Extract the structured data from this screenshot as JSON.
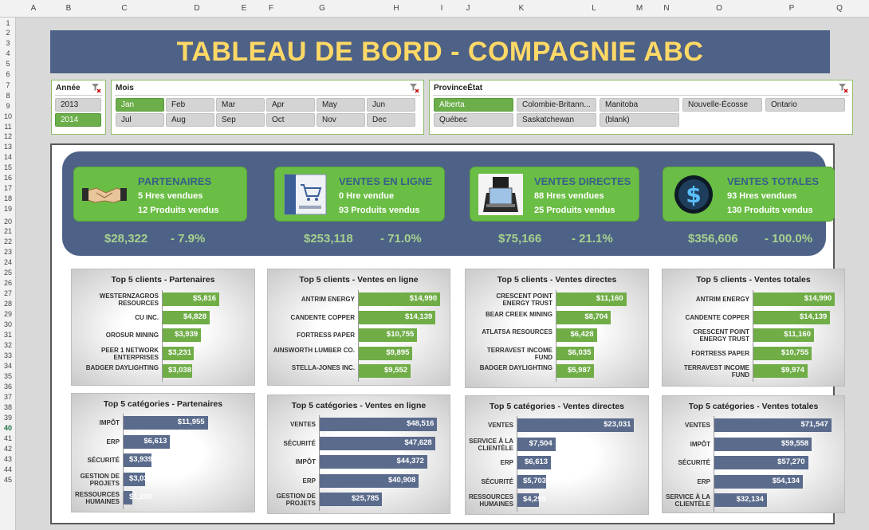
{
  "sheet": {
    "columns": [
      "A",
      "B",
      "C",
      "D",
      "E",
      "F",
      "G",
      "H",
      "I",
      "J",
      "K",
      "L",
      "M",
      "N",
      "O",
      "P",
      "Q"
    ],
    "rows": [
      "1",
      "2",
      "3",
      "4",
      "5",
      "6",
      "7",
      "8",
      "9",
      "10",
      "11",
      "12",
      "13",
      "14",
      "15",
      "16",
      "17",
      "18",
      "19",
      "20",
      "21",
      "22",
      "23",
      "24",
      "25",
      "26",
      "27",
      "28",
      "29",
      "30",
      "31",
      "32",
      "33",
      "34",
      "35",
      "36",
      "37",
      "38",
      "39",
      "40",
      "41",
      "42",
      "43",
      "44",
      "45"
    ],
    "selected_row": "40"
  },
  "title": "TABLEAU DE BORD - COMPAGNIE ABC",
  "slicers": {
    "annee": {
      "header": "Année",
      "items": [
        {
          "label": "2013",
          "on": false
        },
        {
          "label": "2014",
          "on": true
        }
      ]
    },
    "mois": {
      "header": "Mois",
      "items": [
        {
          "label": "Jan",
          "on": true
        },
        {
          "label": "Feb",
          "on": false
        },
        {
          "label": "Mar",
          "on": false
        },
        {
          "label": "Apr",
          "on": false
        },
        {
          "label": "May",
          "on": false
        },
        {
          "label": "Jun",
          "on": false
        },
        {
          "label": "Jul",
          "on": false
        },
        {
          "label": "Aug",
          "on": false
        },
        {
          "label": "Sep",
          "on": false
        },
        {
          "label": "Oct",
          "on": false
        },
        {
          "label": "Nov",
          "on": false
        },
        {
          "label": "Dec",
          "on": false
        }
      ]
    },
    "province": {
      "header": "ProvinceÉtat",
      "items": [
        {
          "label": "Alberta",
          "on": true
        },
        {
          "label": "Colombie-Britann...",
          "on": false
        },
        {
          "label": "Manitoba",
          "on": false
        },
        {
          "label": "Nouvelle-Écosse",
          "on": false
        },
        {
          "label": "Ontario",
          "on": false
        },
        {
          "label": "Québec",
          "on": false
        },
        {
          "label": "Saskatchewan",
          "on": false
        },
        {
          "label": "(blank)",
          "on": false
        }
      ]
    }
  },
  "kpis": [
    {
      "name": "PARTENAIRES",
      "line1": "5 Hres vendues",
      "line2": "12 Produits vendus",
      "amount": "$28,322",
      "pct": "- 7.9%",
      "icon": "handshake-icon"
    },
    {
      "name": "VENTES EN LIGNE",
      "line1": "0 Hre vendue",
      "line2": "93 Produits vendus",
      "amount": "$253,118",
      "pct": "- 71.0%",
      "icon": "online-cart-icon"
    },
    {
      "name": "VENTES DIRECTES",
      "line1": "88 Hres vendues",
      "line2": "25 Produits vendus",
      "amount": "$75,166",
      "pct": "- 21.1%",
      "icon": "salesperson-laptop-icon"
    },
    {
      "name": "VENTES TOTALES",
      "line1": "93 Hres vendues",
      "line2": "130 Produits vendus",
      "amount": "$356,606",
      "pct": "- 100.0%",
      "icon": "dollar-coin-icon"
    }
  ],
  "colors": {
    "kpi_green": "#6bbe45",
    "band_navy": "#4e6287",
    "title_gold": "#ffd966",
    "bar_green": "#70ad47",
    "bar_slate": "#5a6b8c"
  },
  "chart_data": [
    {
      "type": "bar",
      "title": "Top 5 clients - Partenaires",
      "categories": [
        "WESTERNZAGROS RESOURCES",
        "CU INC.",
        "OROSUR MINING",
        "PEER 1 NETWORK ENTERPRISES",
        "BADGER DAYLIGHTING"
      ],
      "values": [
        5816,
        4828,
        3939,
        3231,
        3038
      ],
      "value_labels": [
        "$5,816",
        "$4,828",
        "$3,939",
        "$3,231",
        "$3,038"
      ],
      "xlim": [
        0,
        9000
      ]
    },
    {
      "type": "bar",
      "title": "Top 5 clients - Ventes en ligne",
      "categories": [
        "ANTRIM ENERGY",
        "CANDENTE COPPER",
        "FORTRESS PAPER",
        "AINSWORTH LUMBER CO.",
        "STELLA-JONES INC."
      ],
      "values": [
        14990,
        14139,
        10755,
        9895,
        9552
      ],
      "value_labels": [
        "$14,990",
        "$14,139",
        "$10,755",
        "$9,895",
        "$9,552"
      ],
      "xlim": [
        0,
        16000
      ]
    },
    {
      "type": "bar",
      "title": "Top 5 clients - Ventes directes",
      "categories": [
        "CRESCENT POINT ENERGY TRUST",
        "BEAR CREEK MINING",
        "ATLATSA RESOURCES",
        "TERRAVEST INCOME FUND",
        "BADGER DAYLIGHTING"
      ],
      "values": [
        11160,
        8704,
        6428,
        6035,
        5987
      ],
      "value_labels": [
        "$11,160",
        "$8,704",
        "$6,428",
        "$6,035",
        "$5,987"
      ],
      "xlim": [
        0,
        14000
      ]
    },
    {
      "type": "bar",
      "title": "Top 5 clients - Ventes totales",
      "categories": [
        "ANTRIM ENERGY",
        "CANDENTE COPPER",
        "CRESCENT POINT ENERGY TRUST",
        "FORTRESS PAPER",
        "TERRAVEST INCOME FUND"
      ],
      "values": [
        14990,
        14139,
        11160,
        10755,
        9974
      ],
      "value_labels": [
        "$14,990",
        "$14,139",
        "$11,160",
        "$10,755",
        "$9,974"
      ],
      "xlim": [
        0,
        16000
      ]
    },
    {
      "type": "bar",
      "title": "Top 5 catégories - Partenaires",
      "categories": [
        "IMPÔT",
        "ERP",
        "SÉCURITÉ",
        "GESTION DE PROJETS",
        "RESSOURCES HUMAINES"
      ],
      "values": [
        11955,
        6613,
        3939,
        3038,
        1200
      ],
      "value_labels": [
        "$11,955",
        "$6,613",
        "$3,939",
        "$3,038",
        "$1,200"
      ],
      "xlim": [
        0,
        18000
      ]
    },
    {
      "type": "bar",
      "title": "Top 5 catégories - Ventes en ligne",
      "categories": [
        "VENTES",
        "SÉCURITÉ",
        "IMPÔT",
        "ERP",
        "GESTION DE PROJETS"
      ],
      "values": [
        48516,
        47628,
        44372,
        40908,
        25785
      ],
      "value_labels": [
        "$48,516",
        "$47,628",
        "$44,372",
        "$40,908",
        "$25,785"
      ],
      "xlim": [
        0,
        52000
      ]
    },
    {
      "type": "bar",
      "title": "Top 5 catégories - Ventes directes",
      "categories": [
        "VENTES",
        "SERVICE À LA CLIENTÈLE",
        "ERP",
        "SÉCURITÉ",
        "RESSOURCES HUMAINES"
      ],
      "values": [
        23031,
        7504,
        6613,
        5703,
        4295
      ],
      "value_labels": [
        "$23,031",
        "$7,504",
        "$6,613",
        "$5,703",
        "$4,295"
      ],
      "xlim": [
        0,
        25000
      ]
    },
    {
      "type": "bar",
      "title": "Top 5 catégories - Ventes totales",
      "categories": [
        "VENTES",
        "IMPÔT",
        "SÉCURITÉ",
        "ERP",
        "SERVICE À LA CLIENTÈLE"
      ],
      "values": [
        71547,
        59558,
        57270,
        54134,
        32134
      ],
      "value_labels": [
        "$71,547",
        "$59,558",
        "$57,270",
        "$54,134",
        "$32,134"
      ],
      "xlim": [
        0,
        77000
      ]
    }
  ]
}
